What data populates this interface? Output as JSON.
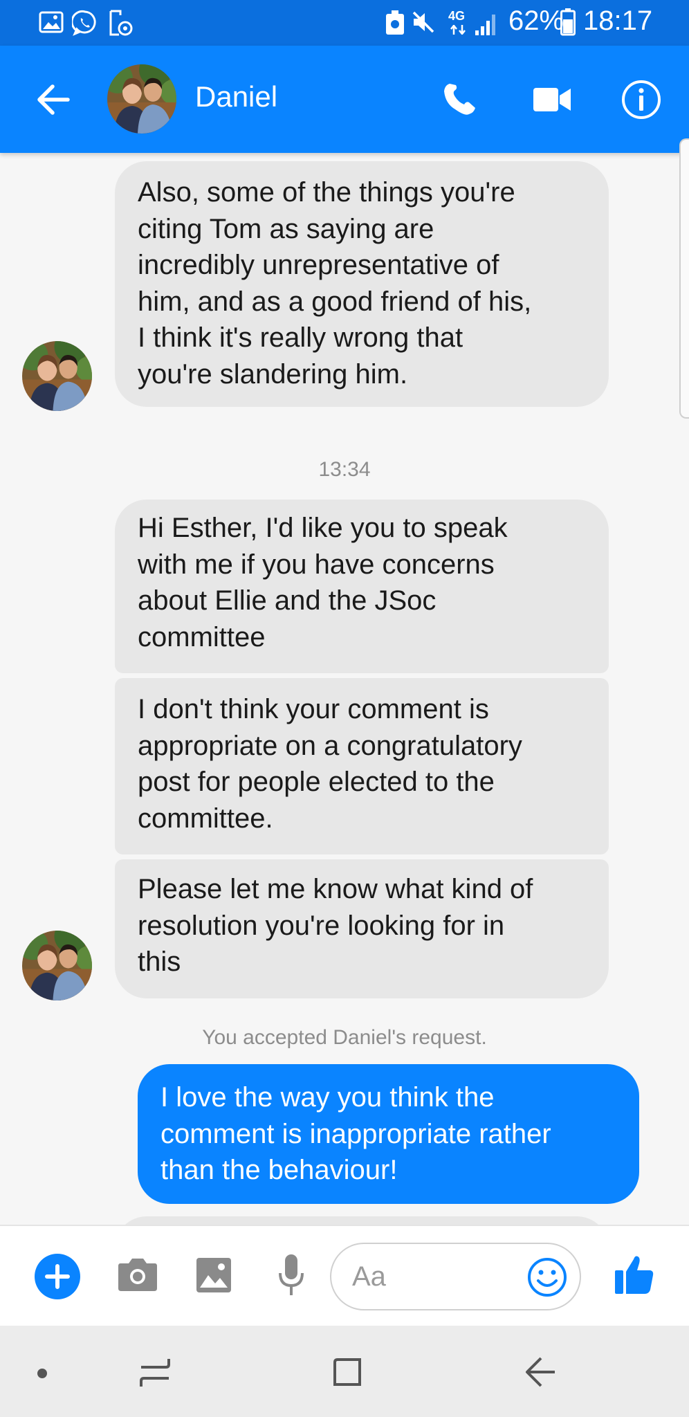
{
  "status_bar": {
    "battery_percent": "62%",
    "time": "18:17",
    "network": "4G",
    "left_icons": [
      "gallery-icon",
      "whatsapp-icon",
      "screen-record-icon"
    ],
    "right_icons": [
      "nfc-icon",
      "mute-icon",
      "signal-icon",
      "battery-icon"
    ]
  },
  "header": {
    "contact_name": "Daniel",
    "icons": [
      "back-arrow-icon",
      "phone-icon",
      "video-camera-icon",
      "info-icon"
    ]
  },
  "messages": [
    {
      "direction": "incoming",
      "text": "Also, some of the things you're\nciting Tom as saying are\nincredibly unrepresentative of\nhim, and as a good friend of his,\nI think it's really wrong that\nyou're slandering him."
    },
    {
      "type": "timestamp",
      "text": "13:34"
    },
    {
      "direction": "incoming",
      "text": "Hi Esther, I'd like you to speak\nwith me if you have concerns\nabout Ellie and the JSoc\ncommittee"
    },
    {
      "direction": "incoming",
      "text": "I don't think your comment is\nappropriate on a congratulatory\npost for people elected to the\ncommittee."
    },
    {
      "direction": "incoming",
      "text": "Please let me know what kind of\nresolution you're looking for in\nthis"
    },
    {
      "type": "system",
      "text": "You accepted Daniel's request."
    },
    {
      "direction": "outgoing",
      "text": "I love the way you think the\ncomment is inappropriate rather\nthan the behaviour!"
    }
  ],
  "composer": {
    "placeholder": "Aa",
    "value": "",
    "icons": [
      "plus-icon",
      "camera-icon",
      "image-icon",
      "microphone-icon",
      "emoji-icon",
      "thumbs-up-icon"
    ]
  },
  "nav_bar": {
    "icons": [
      "dot-icon",
      "recents-icon",
      "home-icon",
      "back-icon"
    ]
  },
  "colors": {
    "status_bar": "#0b6fde",
    "header": "#0a84ff",
    "outgoing_bubble": "#0a84ff",
    "incoming_bubble": "#e7e7e7",
    "chat_background": "#f6f6f6"
  }
}
